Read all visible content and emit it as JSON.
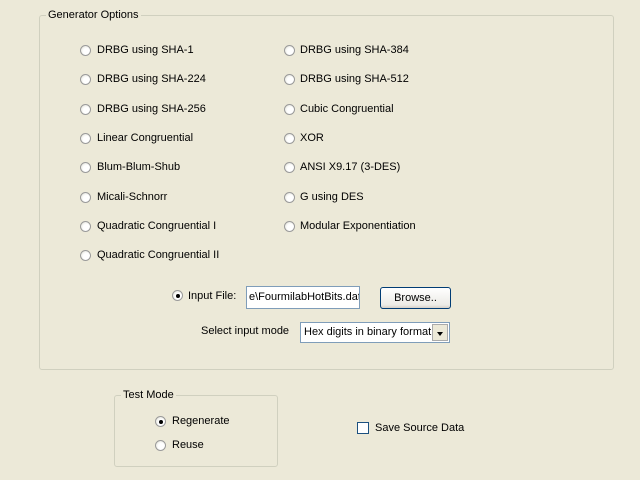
{
  "generator_options": {
    "title": "Generator Options",
    "left": [
      "DRBG using SHA-1",
      "DRBG using SHA-224",
      "DRBG using SHA-256",
      "Linear Congruential",
      "Blum-Blum-Shub",
      "Micali-Schnorr",
      "Quadratic Congruential I",
      "Quadratic Congruential II"
    ],
    "right": [
      "DRBG using SHA-384",
      "DRBG using SHA-512",
      "Cubic Congruential",
      "XOR",
      "ANSI X9.17 (3-DES)",
      "G using DES",
      "Modular Exponentiation"
    ],
    "input_file_label": "Input File:",
    "input_file_value": "e\\FourmilabHotBits.dat",
    "browse_label": "Browse..",
    "input_mode_label": "Select input mode",
    "input_mode_value": "Hex digits in binary format"
  },
  "test_mode": {
    "title": "Test Mode",
    "options": [
      "Regenerate",
      "Reuse"
    ],
    "selected": "Regenerate"
  },
  "save_source_data": {
    "label": "Save Source Data",
    "checked": false
  }
}
